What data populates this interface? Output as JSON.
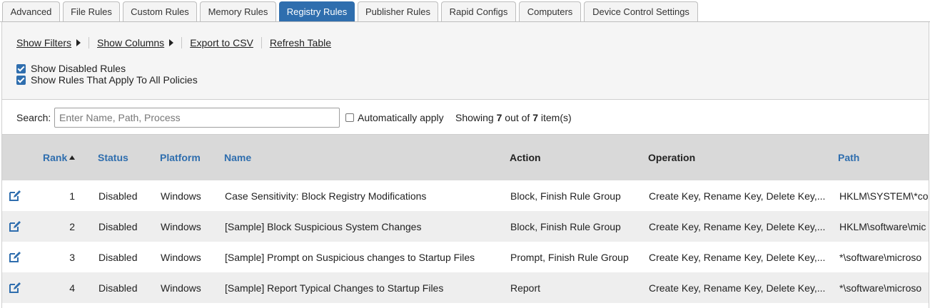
{
  "tabs": [
    {
      "label": "Advanced",
      "active": false
    },
    {
      "label": "File Rules",
      "active": false
    },
    {
      "label": "Custom Rules",
      "active": false
    },
    {
      "label": "Memory Rules",
      "active": false
    },
    {
      "label": "Registry Rules",
      "active": true
    },
    {
      "label": "Publisher Rules",
      "active": false
    },
    {
      "label": "Rapid Configs",
      "active": false
    },
    {
      "label": "Computers",
      "active": false
    },
    {
      "label": "Device Control Settings",
      "active": false
    }
  ],
  "toolbar": {
    "show_filters": "Show Filters",
    "show_columns": "Show Columns",
    "export_csv": "Export to CSV",
    "refresh_table": "Refresh Table",
    "show_disabled_rules": "Show Disabled Rules",
    "show_all_policies": "Show Rules That Apply To All Policies"
  },
  "search": {
    "label": "Search:",
    "placeholder": "Enter Name, Path, Process",
    "value": "",
    "auto_apply": "Automatically apply",
    "showing_prefix": "Showing",
    "shown_count": "7",
    "mid": "out of",
    "total_count": "7",
    "suffix": "item(s)"
  },
  "table": {
    "columns": {
      "rank": "Rank",
      "status": "Status",
      "platform": "Platform",
      "name": "Name",
      "action": "Action",
      "operation": "Operation",
      "path": "Path"
    },
    "rows": [
      {
        "rank": "1",
        "status": "Disabled",
        "platform": "Windows",
        "name": "Case Sensitivity: Block Registry Modifications",
        "action": "Block, Finish Rule Group",
        "operation": "Create Key, Rename Key, Delete Key,...",
        "path": "HKLM\\SYSTEM\\*co"
      },
      {
        "rank": "2",
        "status": "Disabled",
        "platform": "Windows",
        "name": "[Sample] Block Suspicious System Changes",
        "action": "Block, Finish Rule Group",
        "operation": "Create Key, Rename Key, Delete Key,...",
        "path": "HKLM\\software\\mic"
      },
      {
        "rank": "3",
        "status": "Disabled",
        "platform": "Windows",
        "name": "[Sample] Prompt on Suspicious changes to Startup Files",
        "action": "Prompt, Finish Rule Group",
        "operation": "Create Key, Rename Key, Delete Key,...",
        "path": "*\\software\\microso"
      },
      {
        "rank": "4",
        "status": "Disabled",
        "platform": "Windows",
        "name": "[Sample] Report Typical Changes to Startup Files",
        "action": "Report",
        "operation": "Create Key, Rename Key, Delete Key,...",
        "path": "*\\software\\microso"
      }
    ]
  },
  "icons": {
    "edit": "edit-icon",
    "sort_asc": "sort-ascending-icon",
    "caret": "caret-right-icon"
  },
  "colors": {
    "accent": "#2f6eae",
    "header_bg": "#d9d9d9",
    "row_alt": "#eeeeee",
    "toolbar_bg": "#f5f5f5"
  }
}
